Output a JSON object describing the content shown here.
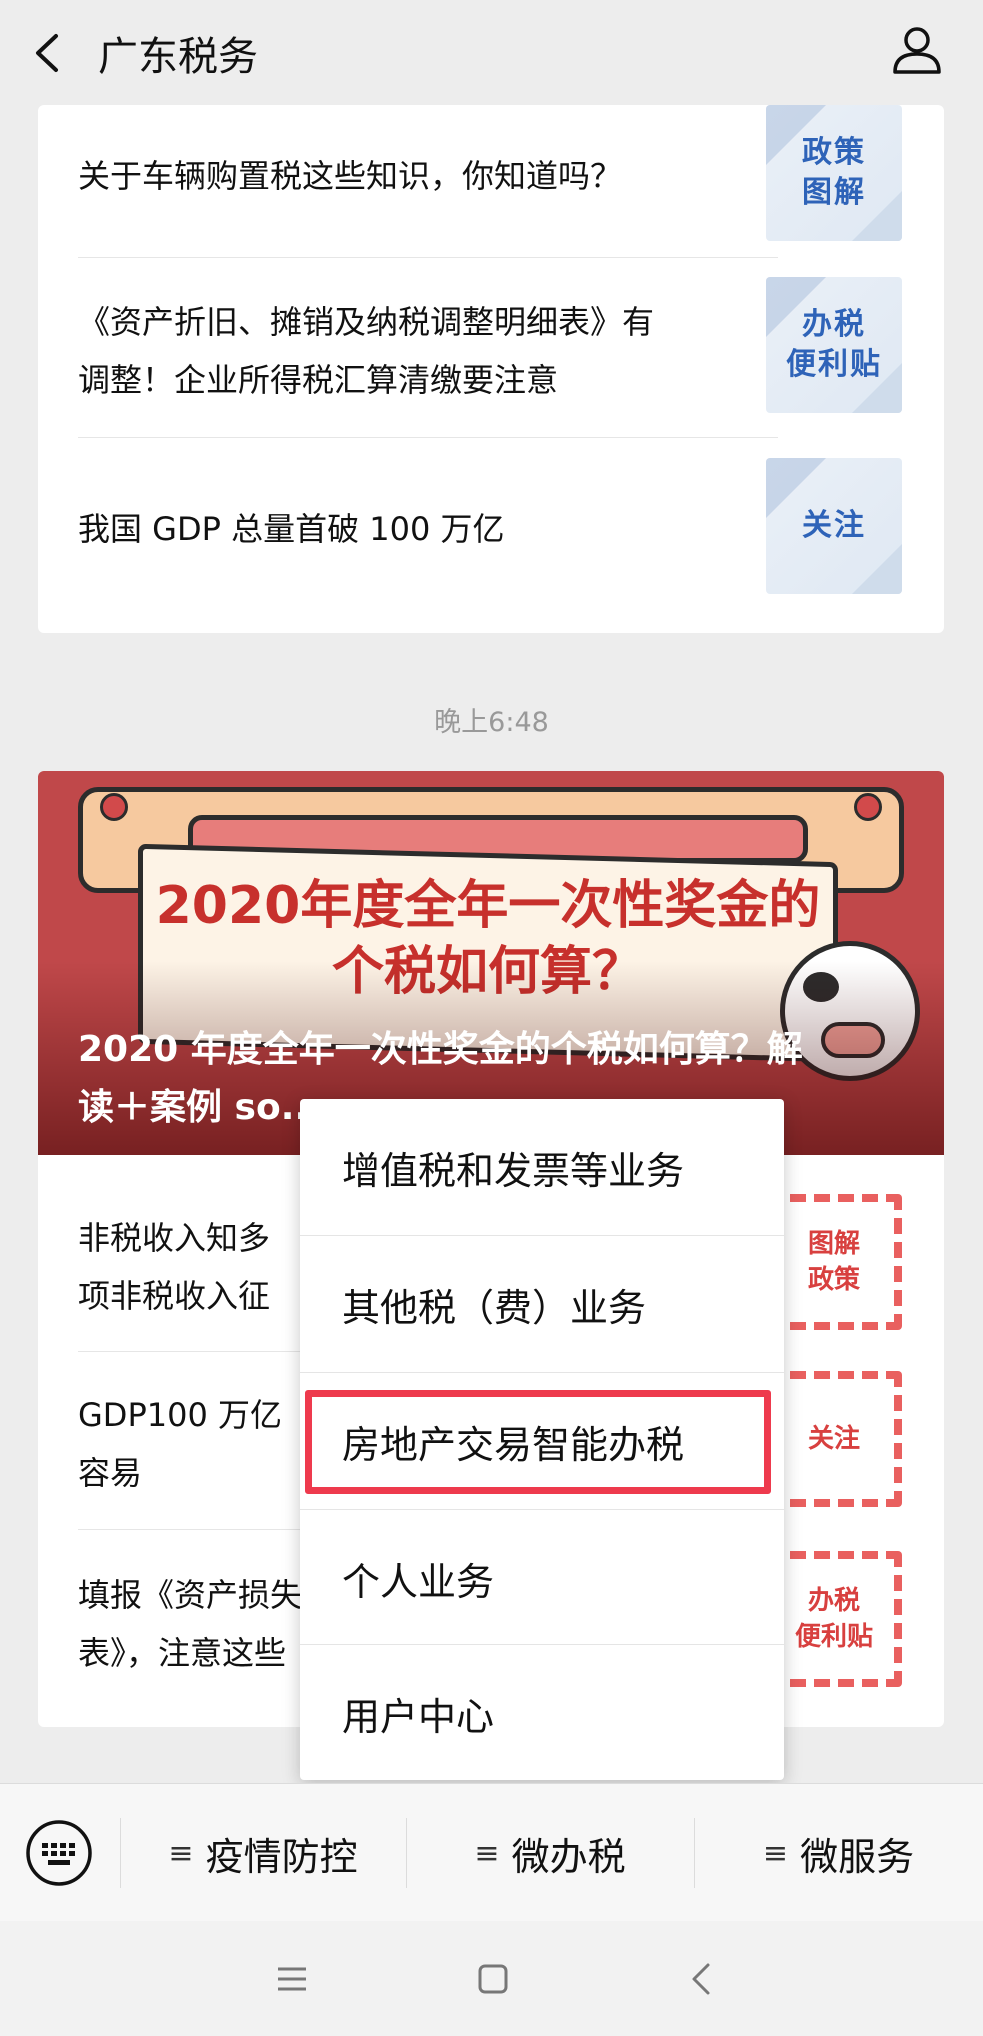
{
  "header": {
    "title": "广东税务"
  },
  "card1": {
    "items": [
      {
        "title": "关于车辆购置税这些知识，你知道吗？",
        "thumb": [
          "政策",
          "图解"
        ]
      },
      {
        "title_lines": [
          "《资产折旧、摊销及纳税调整明细表》有",
          "调整！企业所得税汇算清缴要注意"
        ],
        "thumb": [
          "办税",
          "便利贴"
        ]
      },
      {
        "title": "我国 GDP 总量首破 100 万亿",
        "thumb": [
          "关注"
        ]
      }
    ]
  },
  "timestamp": "晚上6:48",
  "card2": {
    "banner": {
      "art_lines": [
        "2020年度全年一次性奖金的",
        "个税如何算？"
      ],
      "caption_lines": [
        "2020 年度全年一次性奖金的个税如何算？解",
        "读＋案例 so..."
      ]
    },
    "items": [
      {
        "title_lines": [
          "非税收入知多",
          "项非税收入征"
        ],
        "thumb": [
          "图解",
          "政策"
        ]
      },
      {
        "title_lines": [
          "GDP100 万亿",
          "容易"
        ],
        "thumb": [
          "关注"
        ]
      },
      {
        "title_lines": [
          "填报《资产损失",
          "表》，注意这些"
        ],
        "thumb": [
          "办税",
          "便利贴"
        ]
      }
    ]
  },
  "menu": {
    "items": [
      "增值税和发票等业务",
      "其他税（费）业务",
      "房地产交易智能办税",
      "个人业务",
      "用户中心"
    ],
    "highlighted_index": 2,
    "highlight_color": "#ee3a4d"
  },
  "bottom_bar": {
    "items": [
      "疫情防控",
      "微办税",
      "微服务"
    ],
    "prefix_icon": "≡"
  },
  "icons": {
    "back": "chevron-left-icon",
    "user": "user-icon",
    "keyboard": "keyboard-icon"
  }
}
